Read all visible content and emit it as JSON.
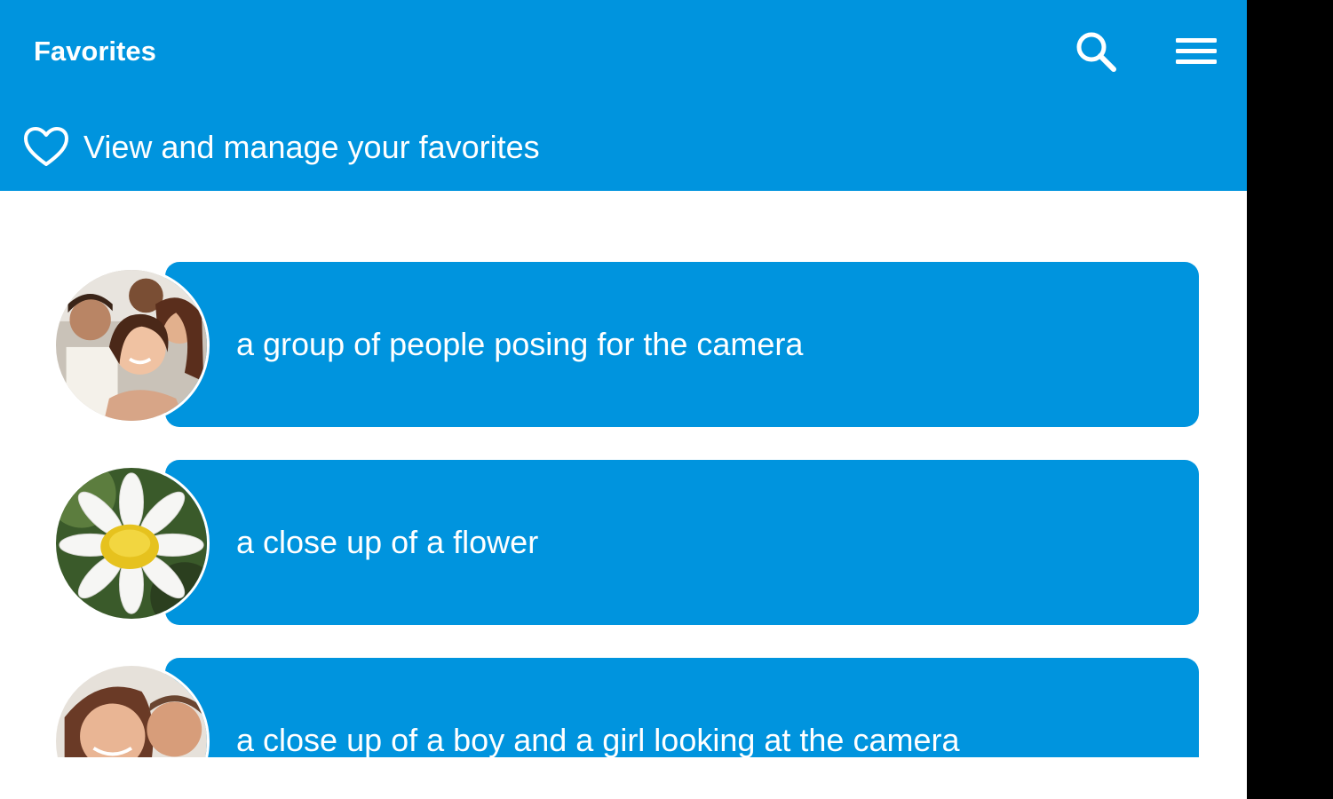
{
  "header": {
    "title": "Favorites",
    "subtitle": "View and manage your favorites",
    "color": "#0094de"
  },
  "icons": {
    "search": "search-icon",
    "menu": "hamburger-menu-icon",
    "favorite": "heart-outline-icon"
  },
  "favorites": [
    {
      "caption": "a group of people posing for the camera",
      "thumbnail": "group-of-people-photo"
    },
    {
      "caption": "a close up of a flower",
      "thumbnail": "daisy-flower-photo"
    },
    {
      "caption": "a close up of a boy and a girl looking at the camera",
      "thumbnail": "woman-and-boy-photo"
    }
  ]
}
